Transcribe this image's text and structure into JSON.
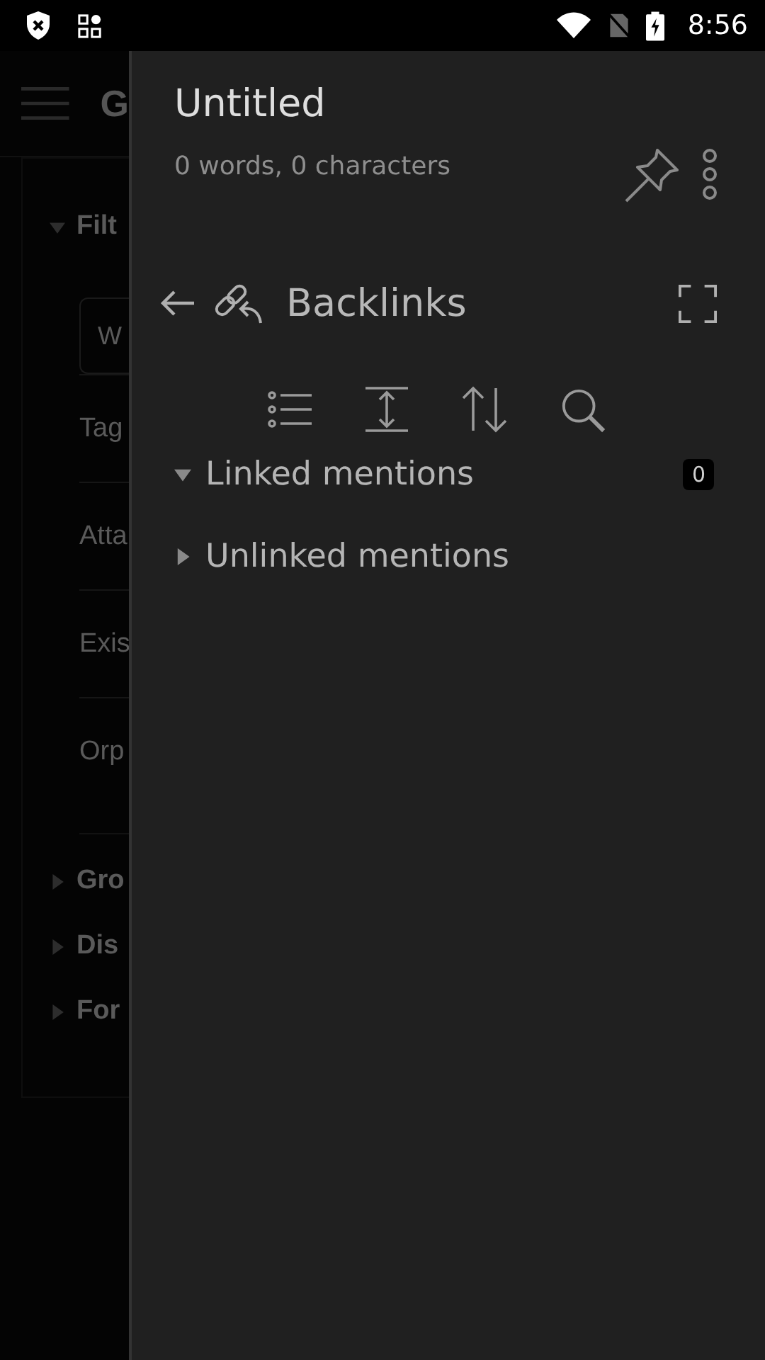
{
  "status_bar": {
    "time": "8:56"
  },
  "background_page": {
    "title": "G",
    "filters": {
      "label": "Filt",
      "expanded": true,
      "search": {
        "placeholder": "W"
      },
      "rows": [
        "Tag",
        "Atta",
        "Exis",
        "Orp"
      ]
    },
    "sections": [
      {
        "label": "Gro",
        "expanded": false
      },
      {
        "label": "Dis",
        "expanded": false
      },
      {
        "label": "For",
        "expanded": false
      }
    ]
  },
  "drawer": {
    "title": "Untitled",
    "subtitle": "0 words, 0 characters",
    "pane": {
      "title": "Backlinks",
      "groups": [
        {
          "label": "Linked mentions",
          "expanded": true,
          "count": "0"
        },
        {
          "label": "Unlinked mentions",
          "expanded": false
        }
      ]
    }
  }
}
